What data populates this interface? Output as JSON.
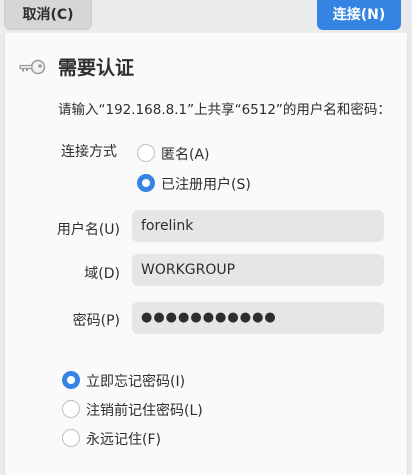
{
  "header": {
    "cancel_label": "取消(C)",
    "connect_label": "连接(N)"
  },
  "dialog": {
    "icon": "key-icon",
    "title": "需要认证",
    "message": "请输入“192.168.8.1”上共享“6512”的用户名和密码："
  },
  "connect_method": {
    "label": "连接方式",
    "options": [
      {
        "label": "匿名(A)",
        "checked": false
      },
      {
        "label": "已注册用户(S)",
        "checked": true
      }
    ]
  },
  "fields": {
    "username": {
      "label": "用户名(U)",
      "value": "forelink"
    },
    "domain": {
      "label": "域(D)",
      "value": "WORKGROUP"
    },
    "password": {
      "label": "密码(P)",
      "value": "●●●●●●●●●●●"
    }
  },
  "remember": {
    "options": [
      {
        "label": "立即忘记密码(I)",
        "checked": true
      },
      {
        "label": "注销前记住密码(L)",
        "checked": false
      },
      {
        "label": "永远记住(F)",
        "checked": false
      }
    ]
  },
  "colors": {
    "accent": "#3584e4",
    "background": "#fafafa",
    "headerbar": "#ebebeb"
  }
}
